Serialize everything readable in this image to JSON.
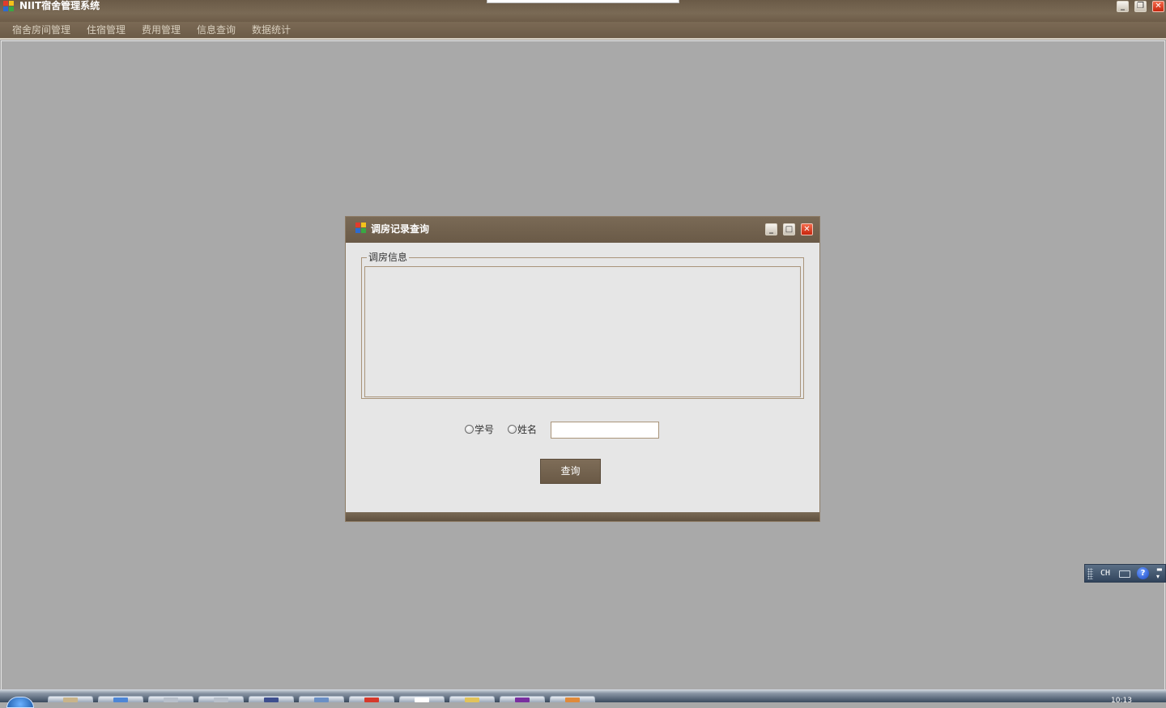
{
  "window": {
    "title": "NIIT宿舍管理系统",
    "controls": {
      "minimize": "minimize",
      "restore": "restore",
      "close": "close"
    }
  },
  "menu": {
    "items": [
      "宿舍房间管理",
      "住宿管理",
      "费用管理",
      "信息查询",
      "数据统计"
    ]
  },
  "dialog": {
    "title": "调房记录查询",
    "group_title": "调房信息",
    "radio_student_id": "学号",
    "radio_name": "姓名",
    "search_value": "",
    "search_placeholder": "",
    "query_button": "查询"
  },
  "ime": {
    "language": "CH",
    "help": "?"
  },
  "taskbar": {
    "clock": "10:13"
  },
  "colors": {
    "title_brown": "#6e5d4a",
    "menu_text": "#d8cfbe",
    "client_gray": "#a9a9a9",
    "dialog_bg": "#e6e6e6",
    "close_red": "#d8391c"
  }
}
